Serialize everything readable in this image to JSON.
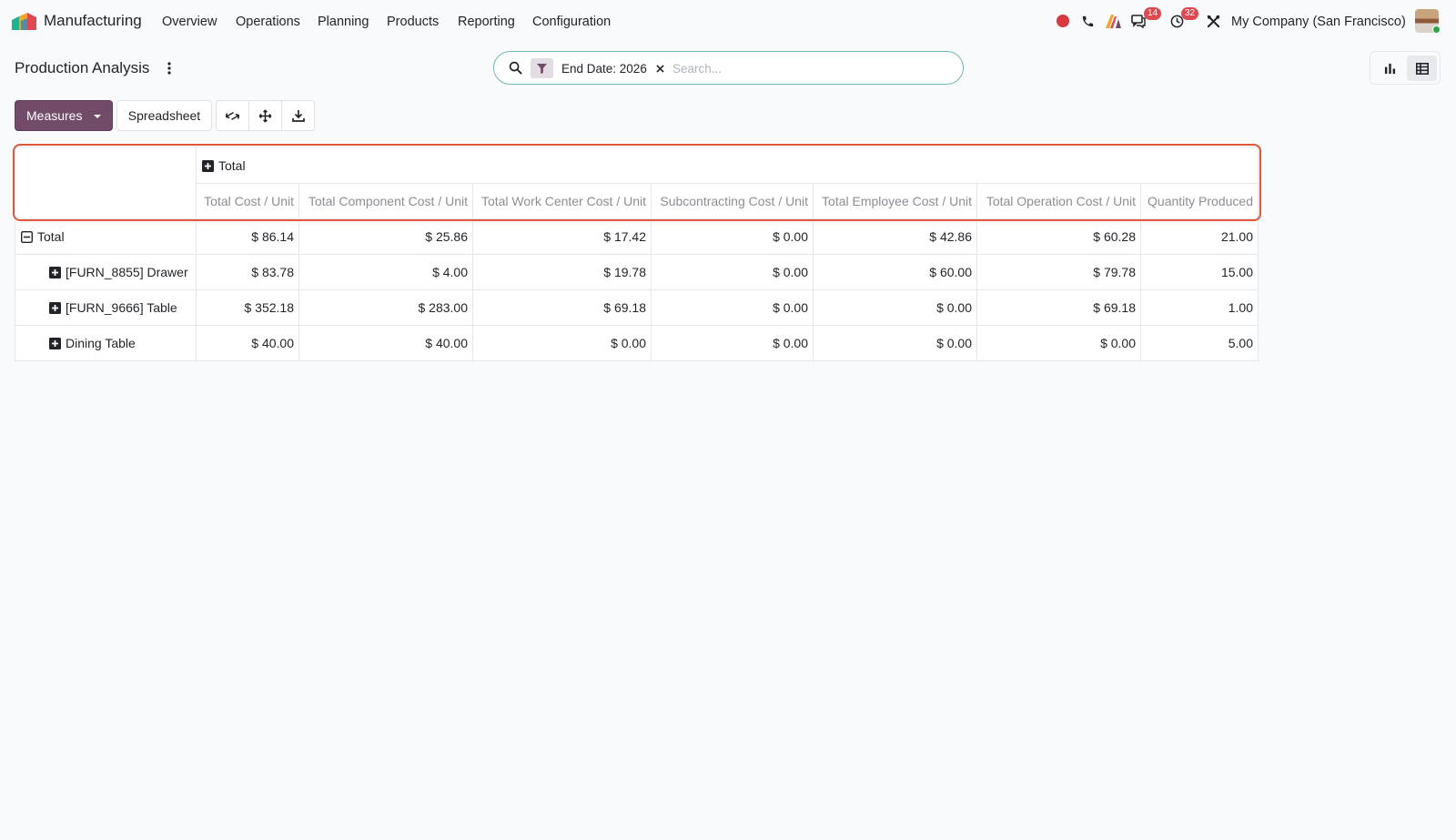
{
  "app": {
    "name": "Manufacturing"
  },
  "nav": {
    "menus": [
      "Overview",
      "Operations",
      "Planning",
      "Products",
      "Reporting",
      "Configuration"
    ],
    "messages_badge": "14",
    "activities_badge": "32",
    "company": "My Company (San Francisco)"
  },
  "control_panel": {
    "title": "Production Analysis",
    "search": {
      "facet": "End Date: 2026",
      "placeholder": "Search..."
    },
    "buttons": {
      "measures": "Measures",
      "spreadsheet": "Spreadsheet"
    }
  },
  "pivot": {
    "column_group": "Total",
    "measures": [
      "Total Cost / Unit",
      "Total Component Cost / Unit",
      "Total Work Center Cost / Unit",
      "Subcontracting Cost / Unit",
      "Total Employee Cost / Unit",
      "Total Operation Cost / Unit",
      "Quantity Produced"
    ],
    "rows": [
      {
        "label": "Total",
        "values": [
          "$ 86.14",
          "$ 25.86",
          "$ 17.42",
          "$ 0.00",
          "$ 42.86",
          "$ 60.28",
          "21.00"
        ]
      },
      {
        "label": "[FURN_8855] Drawer",
        "values": [
          "$ 83.78",
          "$ 4.00",
          "$ 19.78",
          "$ 0.00",
          "$ 60.00",
          "$ 79.78",
          "15.00"
        ]
      },
      {
        "label": "[FURN_9666] Table",
        "values": [
          "$ 352.18",
          "$ 283.00",
          "$ 69.18",
          "$ 0.00",
          "$ 0.00",
          "$ 69.18",
          "1.00"
        ]
      },
      {
        "label": "Dining Table",
        "values": [
          "$ 40.00",
          "$ 40.00",
          "$ 0.00",
          "$ 0.00",
          "$ 0.00",
          "$ 0.00",
          "5.00"
        ]
      }
    ]
  },
  "colors": {
    "brand": "#714b67",
    "highlight": "#e0573a",
    "badge": "#e0474f",
    "search_border": "#6cb9b3"
  }
}
